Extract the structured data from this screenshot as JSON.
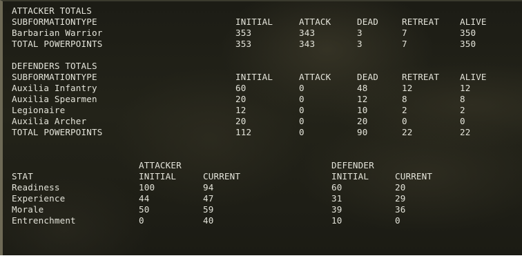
{
  "attacker_totals": {
    "title": "ATTACKER TOTALS",
    "columns": [
      "SUBFORMATIONTYPE",
      "INITIAL",
      "ATTACK",
      "DEAD",
      "RETREAT",
      "ALIVE"
    ],
    "rows": [
      [
        "Barbarian Warrior",
        "353",
        "343",
        "3",
        "7",
        "350"
      ],
      [
        "TOTAL POWERPOINTS",
        "353",
        "343",
        "3",
        "7",
        "350"
      ]
    ]
  },
  "defender_totals": {
    "title": "DEFENDERS TOTALS",
    "columns": [
      "SUBFORMATIONTYPE",
      "INITIAL",
      "ATTACK",
      "DEAD",
      "RETREAT",
      "ALIVE"
    ],
    "rows": [
      [
        "Auxilia Infantry",
        "60",
        "0",
        "48",
        "12",
        "12"
      ],
      [
        "Auxilia Spearmen",
        "20",
        "0",
        "12",
        "8",
        "8"
      ],
      [
        "Legionaire",
        "12",
        "0",
        "10",
        "2",
        "2"
      ],
      [
        "Auxilia Archer",
        "20",
        "0",
        "20",
        "0",
        "0"
      ],
      [
        "TOTAL POWERPOINTS",
        "112",
        "0",
        "90",
        "22",
        "22"
      ]
    ]
  },
  "stats": {
    "attacker_label": "ATTACKER",
    "defender_label": "DEFENDER",
    "columns": [
      "STAT",
      "INITIAL",
      "CURRENT",
      "INITIAL",
      "CURRENT"
    ],
    "rows": [
      [
        "Readiness",
        "100",
        "94",
        "60",
        "20"
      ],
      [
        "Experience",
        "44",
        "47",
        "31",
        "29"
      ],
      [
        "Morale",
        "50",
        "59",
        "39",
        "36"
      ],
      [
        "Entrenchment",
        "0",
        "40",
        "10",
        "0"
      ]
    ]
  }
}
